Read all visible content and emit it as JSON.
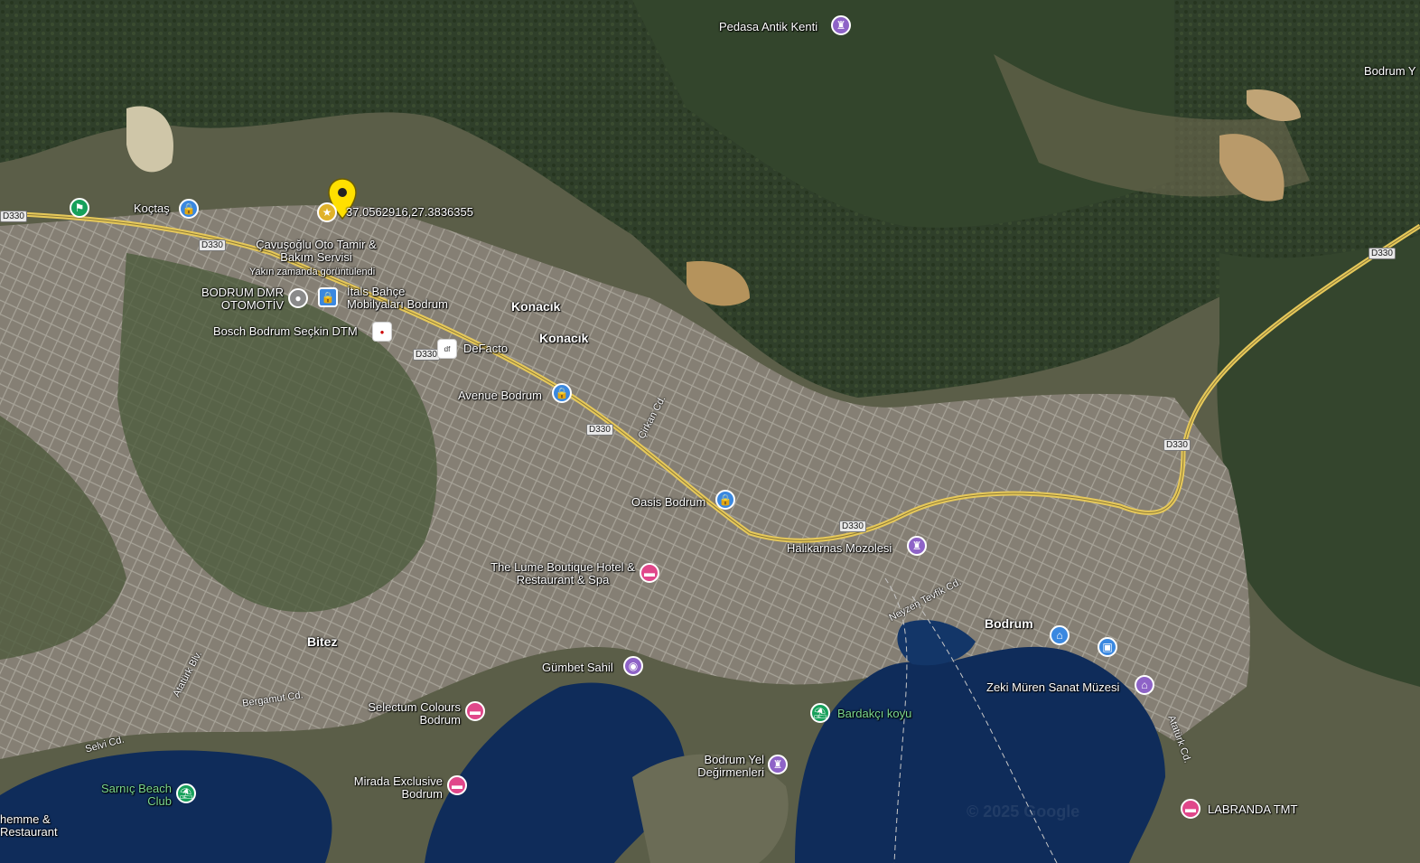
{
  "map": {
    "colors": {
      "forest": "#2f3f2a",
      "hills": "#6b6a55",
      "urban": "#8c8a82",
      "sea": "#0f2c5a",
      "road": "#e7c95a",
      "pin_yellow": "#ffe000"
    },
    "selected_pin": {
      "label": "37.0562916,27.3836355",
      "icon": "map-pin-icon"
    },
    "places": [
      {
        "id": "pedasa",
        "label": "Pedasa Antik Kenti",
        "icon": "monument-icon"
      },
      {
        "id": "bodrum-y",
        "label": "Bodrum Y",
        "icon": ""
      },
      {
        "id": "koctas",
        "label": "Koçtaş",
        "icon": "shopping-icon"
      },
      {
        "id": "cavusoglu",
        "label": "Çavuşoğlu Oto Tamir & Bakım Servisi",
        "sublabel": "Yakın zamanda görüntülendi",
        "icon": "star-icon"
      },
      {
        "id": "bodrum-dmr",
        "label": "BODRUM DMR OTOMOTİV",
        "icon": "place-icon"
      },
      {
        "id": "itals",
        "label": "İtals Bahçe Mobilyaları Bodrum",
        "icon": "shopping-icon"
      },
      {
        "id": "bosch",
        "label": "Bosch Bodrum Seçkin DTM",
        "icon": "logo-icon"
      },
      {
        "id": "defacto",
        "label": "DeFacto",
        "icon": "logo-icon"
      },
      {
        "id": "avenue",
        "label": "Avenue Bodrum",
        "icon": "shopping-icon"
      },
      {
        "id": "oasis",
        "label": "Oasis Bodrum",
        "icon": "shopping-icon"
      },
      {
        "id": "halikarnas",
        "label": "Halikarnas Mozolesi",
        "icon": "monument-icon"
      },
      {
        "id": "lume",
        "label": "The Lume Boutique Hotel & Restaurant & Spa",
        "icon": "hotel-icon"
      },
      {
        "id": "gumbet",
        "label": "Gümbet Sahil",
        "icon": "camera-icon"
      },
      {
        "id": "selectum",
        "label": "Selectum Colours Bodrum",
        "icon": "hotel-icon"
      },
      {
        "id": "mirada",
        "label": "Mirada Exclusive Bodrum",
        "icon": "hotel-icon"
      },
      {
        "id": "sarnic",
        "label": "Sarnıç Beach Club",
        "icon": "beach-icon"
      },
      {
        "id": "hemme",
        "label": "hemme & Restaurant",
        "icon": ""
      },
      {
        "id": "bardakci",
        "label": "Bardakçı koyu",
        "icon": "beach-icon"
      },
      {
        "id": "yel",
        "label": "Bodrum Yel Değirmenleri",
        "icon": "monument-icon"
      },
      {
        "id": "zeki",
        "label": "Zeki Müren Sanat Müzesi",
        "icon": "museum-icon"
      },
      {
        "id": "labranda",
        "label": "LABRANDA TMT",
        "icon": "hotel-icon"
      },
      {
        "id": "bodrum-home",
        "label": "",
        "icon": "home-icon"
      },
      {
        "id": "bodrum-bag",
        "label": "",
        "icon": "briefcase-icon"
      }
    ],
    "areas": {
      "konacik1": "Konacık",
      "konacik2": "Konacık",
      "bitez": "Bitez",
      "bodrum": "Bodrum"
    },
    "roads": {
      "shield": "D330",
      "streets": [
        "Çirkan Cd.",
        "Neyzen Tevfik Cd.",
        "Atatürk Blv.",
        "Bergamut Cd.",
        "Selvi Cd.",
        "Atatürk Cd."
      ]
    },
    "watermark": "© 2025 Google"
  }
}
